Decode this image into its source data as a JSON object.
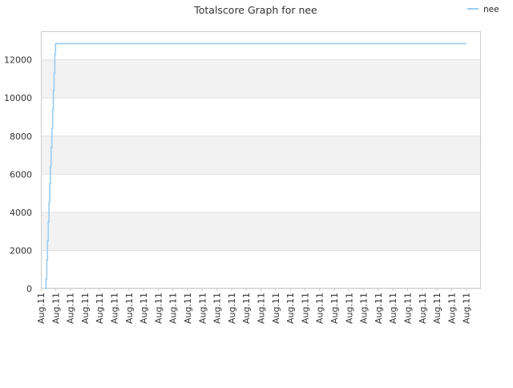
{
  "chart_data": {
    "type": "line",
    "title": "Totalscore Graph for nee",
    "xlabel": "",
    "ylabel": "",
    "ylim": [
      0,
      13500
    ],
    "yticks": [
      0,
      2000,
      4000,
      6000,
      8000,
      10000,
      12000
    ],
    "x_tick_labels": [
      "Aug.11",
      "Aug.11",
      "Aug.11",
      "Aug.11",
      "Aug.11",
      "Aug.11",
      "Aug.11",
      "Aug.11",
      "Aug.11",
      "Aug.11",
      "Aug.11",
      "Aug.11",
      "Aug.11",
      "Aug.11",
      "Aug.11",
      "Aug.11",
      "Aug.11",
      "Aug.11",
      "Aug.11",
      "Aug.11",
      "Aug.11",
      "Aug.11",
      "Aug.11",
      "Aug.11",
      "Aug.11",
      "Aug.11",
      "Aug.11",
      "Aug.11",
      "Aug.11",
      "Aug.11"
    ],
    "grid": true,
    "legend": "top-right",
    "colors": {
      "series": "#99ccf2",
      "band": "#f2f2f2",
      "grid": "#e0e0e0",
      "axis": "#cccccc"
    },
    "series": [
      {
        "name": "nee",
        "x": [
          0.3,
          0.35,
          0.4,
          0.45,
          0.5,
          0.55,
          0.6,
          0.65,
          0.7,
          0.75,
          0.8,
          0.85,
          0.9,
          0.95,
          1.0,
          1.05,
          1.1,
          1.15,
          1.2,
          1.25,
          1.3,
          1.35,
          29.0
        ],
        "y": [
          0,
          500,
          1500,
          2500,
          3500,
          4500,
          5500,
          6400,
          7400,
          8400,
          9400,
          10400,
          11300,
          12300,
          12850,
          12850,
          12850,
          12850,
          12850,
          12850,
          12850,
          12850,
          12850
        ]
      }
    ]
  }
}
